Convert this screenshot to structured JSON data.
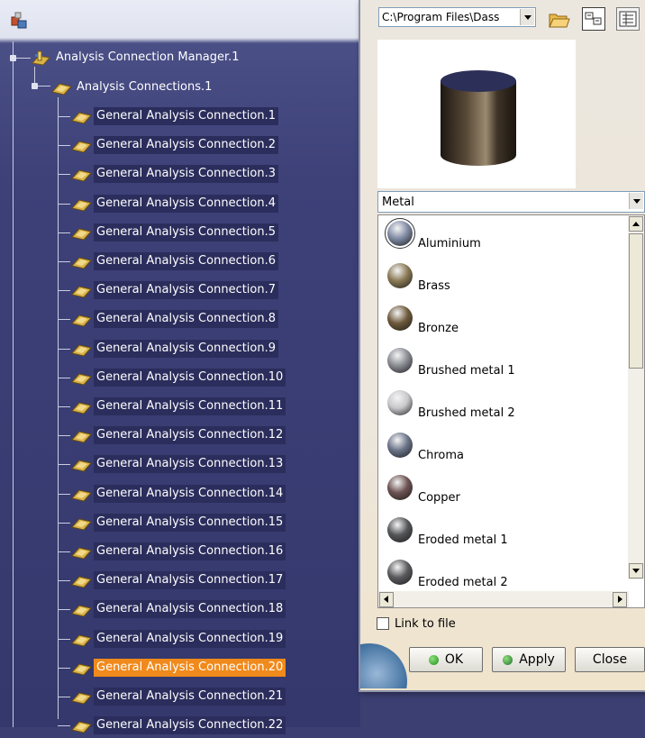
{
  "tree": {
    "root": {
      "label": "Analysis Connection Manager.1",
      "icon": "connection-manager-icon"
    },
    "group": {
      "label": "Analysis Connections.1",
      "icon": "analysis-connection-icon"
    },
    "connections": [
      {
        "label": "General Analysis Connection.1"
      },
      {
        "label": "General Analysis Connection.2"
      },
      {
        "label": "General Analysis Connection.3"
      },
      {
        "label": "General Analysis Connection.4"
      },
      {
        "label": "General Analysis Connection.5"
      },
      {
        "label": "General Analysis Connection.6"
      },
      {
        "label": "General Analysis Connection.7"
      },
      {
        "label": "General Analysis Connection.8"
      },
      {
        "label": "General Analysis Connection.9"
      },
      {
        "label": "General Analysis Connection.10"
      },
      {
        "label": "General Analysis Connection.11"
      },
      {
        "label": "General Analysis Connection.12"
      },
      {
        "label": "General Analysis Connection.13"
      },
      {
        "label": "General Analysis Connection.14"
      },
      {
        "label": "General Analysis Connection.15"
      },
      {
        "label": "General Analysis Connection.16"
      },
      {
        "label": "General Analysis Connection.17"
      },
      {
        "label": "General Analysis Connection.18"
      },
      {
        "label": "General Analysis Connection.19"
      },
      {
        "label": "General Analysis Connection.20",
        "selected": true
      },
      {
        "label": "General Analysis Connection.21"
      },
      {
        "label": "General Analysis Connection.22"
      }
    ]
  },
  "library": {
    "path": "C:\\Program Files\\Dass",
    "category": "Metal",
    "materials": [
      {
        "label": "Aluminium",
        "color": "#7f8aa3"
      },
      {
        "label": "Brass",
        "color": "#8a7a55"
      },
      {
        "label": "Bronze",
        "color": "#6e5a3c"
      },
      {
        "label": "Brushed metal 1",
        "color": "#8a8c93"
      },
      {
        "label": "Brushed metal 2",
        "color": "#c8c8cc"
      },
      {
        "label": "Chroma",
        "color": "#6b7489"
      },
      {
        "label": "Copper",
        "color": "#6d5252"
      },
      {
        "label": "Eroded metal 1",
        "color": "#555659"
      },
      {
        "label": "Eroded metal 2",
        "color": "#5b5b5e"
      }
    ],
    "link_to_file": "Link to file"
  },
  "buttons": {
    "ok": "OK",
    "apply": "Apply",
    "close": "Close"
  },
  "colors": {
    "selection": "#f08a1c",
    "tree_background": "#3b3f72"
  }
}
